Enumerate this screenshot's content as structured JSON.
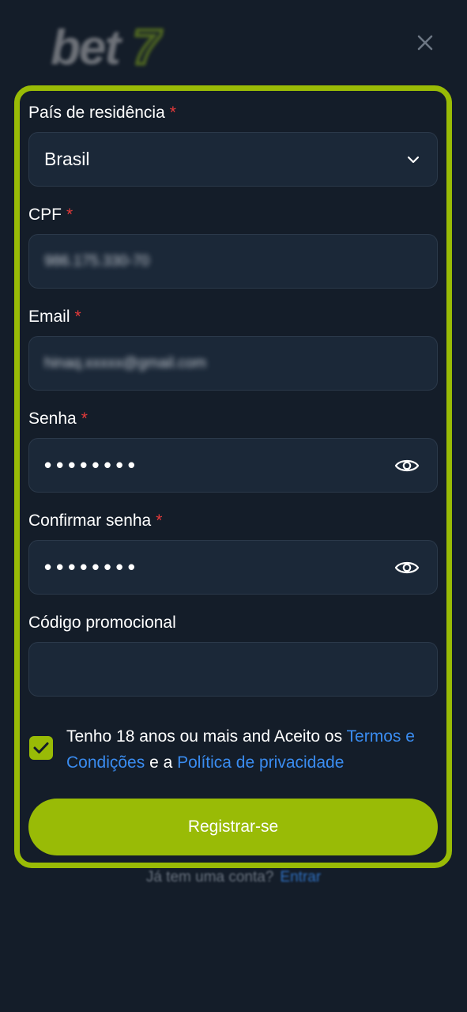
{
  "header": {
    "logo_text": "bet",
    "logo_seven": "7",
    "close_icon": "close-icon"
  },
  "form": {
    "country": {
      "label": "País de residência",
      "required": "*",
      "value": "Brasil",
      "icon": "chevron-down-icon"
    },
    "cpf": {
      "label": "CPF",
      "required": "*",
      "value": "986.175.330-70"
    },
    "email": {
      "label": "Email",
      "required": "*",
      "value": "hinaq.xxxxx@gmail.com"
    },
    "password": {
      "label": "Senha",
      "required": "*",
      "value": "••••••••",
      "icon": "eye-icon"
    },
    "confirm_password": {
      "label": "Confirmar senha",
      "required": "*",
      "value": "••••••••",
      "icon": "eye-icon"
    },
    "promo": {
      "label": "Código promocional",
      "value": ""
    },
    "consent": {
      "checked": true,
      "text_1": "Tenho 18 anos ou mais and Aceito os ",
      "terms_link": "Termos e Condições",
      "text_2": " e a ",
      "privacy_link": "Política de privacidade"
    },
    "submit_label": "Registrar-se"
  },
  "footer": {
    "question": "Já tem uma conta?",
    "login_link": "Entrar"
  },
  "colors": {
    "accent": "#99bb06",
    "link": "#3a8cf0",
    "required": "#e53a3a",
    "background": "#141d29",
    "input_bg": "#1b2838"
  }
}
